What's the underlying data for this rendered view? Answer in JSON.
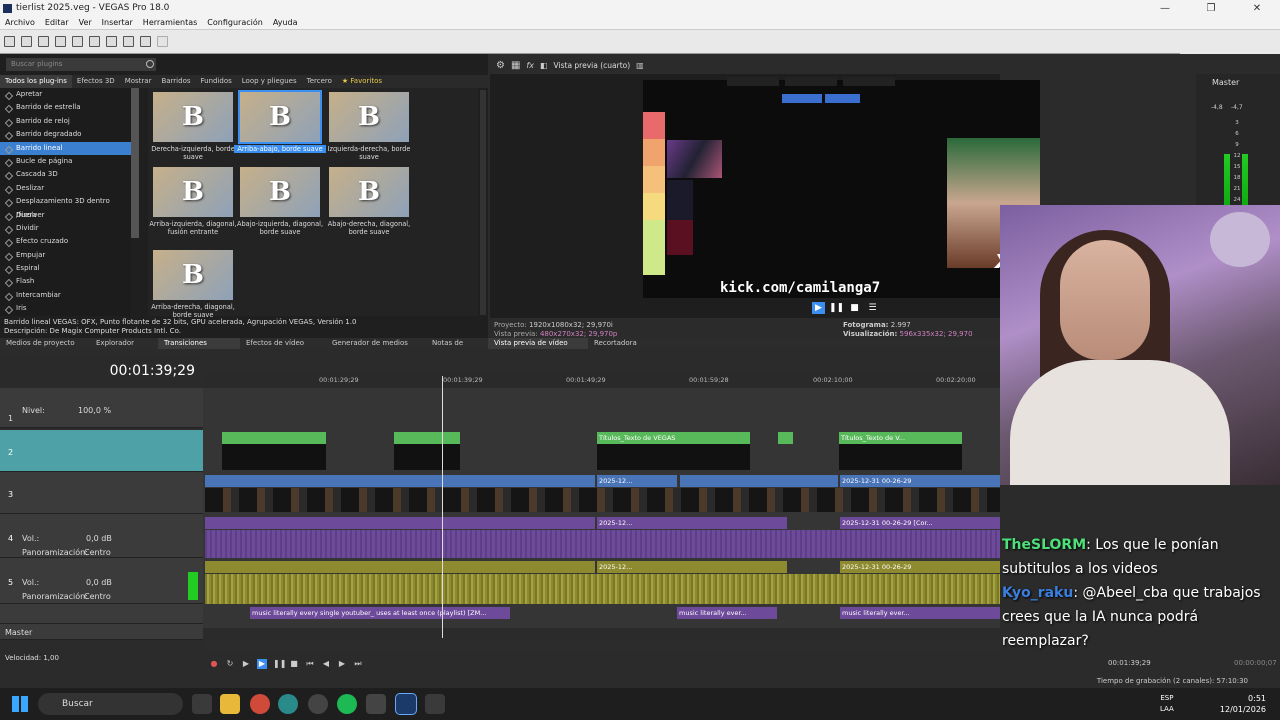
{
  "window": {
    "title": "tierlist 2025.veg - VEGAS Pro 18.0",
    "min": "—",
    "max": "❐",
    "close": "✕"
  },
  "menu": [
    "Archivo",
    "Editar",
    "Ver",
    "Insertar",
    "Herramientas",
    "Configuración",
    "Ayuda"
  ],
  "plugins": {
    "search_placeholder": "Buscar plugins",
    "tabs": [
      "Todos los plug-ins",
      "Efectos 3D",
      "Mostrar",
      "Barridos",
      "Fundidos",
      "Loop y pliegues",
      "Tercero",
      "★ Favoritos"
    ],
    "list": [
      "Apretar",
      "Barrido de estrella",
      "Barrido de reloj",
      "Barrido degradado",
      "Barrido lineal",
      "Bucle de página",
      "Cascada 3D",
      "Deslizar",
      "Desplazamiento 3D dentro /fuera",
      "Disolver",
      "Dividir",
      "Efecto cruzado",
      "Empujar",
      "Espiral",
      "Flash",
      "Intercambiar",
      "Iris"
    ],
    "selected_index": 4,
    "presets": [
      {
        "glyph": "B",
        "caption": "Derecha-izquierda, borde suave"
      },
      {
        "glyph": "B",
        "caption": "Arriba-abajo, borde suave"
      },
      {
        "glyph": "B",
        "caption": "Izquierda-derecha, borde suave"
      },
      {
        "glyph": "B",
        "caption": "Arriba-izquierda, diagonal, fusión entrante"
      },
      {
        "glyph": "B",
        "caption": "Abajo-izquierda, diagonal, borde suave"
      },
      {
        "glyph": "B",
        "caption": "Abajo-derecha, diagonal, borde suave"
      },
      {
        "glyph": "B",
        "caption": "Arriba-derecha, diagonal, borde suave"
      }
    ],
    "description_line1": "Barrido lineal VEGAS: OFX, Punto flotante de 32 bits, GPU acelerada, Agrupación VEGAS, Versión 1.0",
    "description_line2": "Descripción: De Magix Computer Products Intl. Co."
  },
  "lower_tabs": [
    "Medios de proyecto",
    "Explorador",
    "Transiciones",
    "Efectos de vídeo",
    "Generador de medios",
    "Notas de",
    "Vista previa de vídeo",
    "Recortadora"
  ],
  "preview": {
    "mode": "Vista previa (cuarto)",
    "watermark": "kick.com/camilanga7",
    "overlay_text": "x2",
    "project_label": "Proyecto:",
    "project_value": "1920x1080x32; 29,970i",
    "preview_label": "Vista previa:",
    "preview_value": "480x270x32; 29,970p",
    "frame_label": "Fotograma:",
    "frame_value": "2.997",
    "display_label": "Visualización:",
    "display_value": "596x335x32; 29,970"
  },
  "master": {
    "label": "Master",
    "left_level": "-4,8",
    "right_level": "-4,7",
    "scale": [
      "3",
      "6",
      "9",
      "12",
      "15",
      "18",
      "21",
      "24"
    ]
  },
  "timeline": {
    "timecode": "00:01:39;29",
    "ruler": [
      "00:01:29;29",
      "00:01:39;29",
      "00:01:49;29",
      "00:01:59;28",
      "00:02:10;00",
      "00:02:20;00"
    ],
    "level_label": "Nivel:",
    "level_value": "100,0 %",
    "vol_label": "Vol.:",
    "vol_value": "0,0 dB",
    "pan_label": "Panoramización:",
    "pan_value": "Centro",
    "track_numbers": [
      "1",
      "2",
      "3",
      "4",
      "5"
    ],
    "master_label": "Master",
    "speed_label": "Velocidad: 1,00",
    "clips": {
      "titles": "Títulos_Texto de VEGAS",
      "titles_short": "Títulos_Texto de V...",
      "video_a": "2025-12-31 00-26-29",
      "video_b": "2025-12-31 00-26-29 [Cor...",
      "video_c": "2025-12-31 00-26-29 [Corriente 3]",
      "video_d": "2025-12...",
      "music": "music literally every single youtuber_ uses at least once (playlist) [ZM...",
      "music_b": "music literally ever...",
      "music_c": "music literally every single youtuber_ uses at least..."
    },
    "cursor_time": "00:01:39;29",
    "end_time": "00:00:00;07"
  },
  "record_status": "Tiempo de grabación (2 canales): 57:10:30",
  "chat": [
    {
      "user": "TheSLORM",
      "text": ": Los que le ponían subtitulos a los videos"
    },
    {
      "user": "Kyo_raku",
      "text": ": @Abeel_cba que trabajos crees que la IA nunca podrá reemplazar?"
    }
  ],
  "taskbar": {
    "search": "Buscar",
    "lang1": "ESP",
    "lang2": "LAA",
    "time": "0:51",
    "date": "12/01/2026"
  },
  "colors": {
    "accent": "#3b8ff0",
    "track_green": "#57b95a",
    "track_blue": "#4a74b8",
    "track_purple": "#6d4a9a",
    "track_olive": "#8d8a30",
    "chat_user": "#4ee07a"
  }
}
